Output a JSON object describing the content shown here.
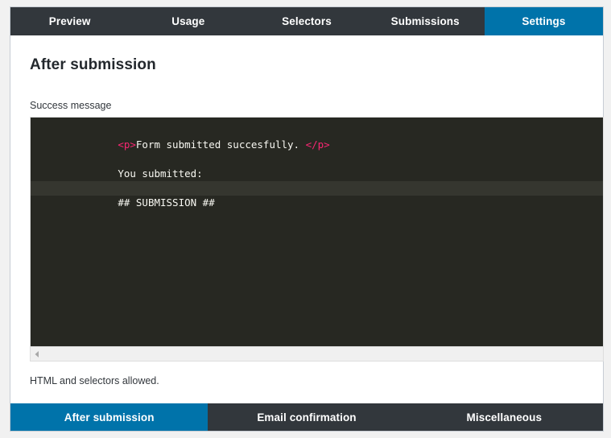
{
  "colors": {
    "accent": "#0073aa",
    "tabbar_bg": "#32373c",
    "panel_bg": "#ffffff",
    "page_bg": "#f1f1f1",
    "editor_bg": "#272822",
    "editor_highlight_bg": "#35362f",
    "editor_text": "#f8f8f2",
    "editor_tag": "#f92672"
  },
  "top_tabs": [
    {
      "label": "Preview",
      "active": false
    },
    {
      "label": "Usage",
      "active": false
    },
    {
      "label": "Selectors",
      "active": false
    },
    {
      "label": "Submissions",
      "active": false
    },
    {
      "label": "Settings",
      "active": true
    }
  ],
  "main": {
    "title": "After submission",
    "field": {
      "label": "Success message",
      "help": "HTML and selectors allowed."
    },
    "editor": {
      "lines": [
        {
          "highlight": false,
          "tokens": [
            {
              "type": "tag",
              "text": "<p>"
            },
            {
              "type": "text",
              "text": "Form submitted succesfully. "
            },
            {
              "type": "tag",
              "text": "</p>"
            }
          ]
        },
        {
          "highlight": false,
          "tokens": []
        },
        {
          "highlight": false,
          "tokens": [
            {
              "type": "text",
              "text": "You submitted:"
            }
          ]
        },
        {
          "highlight": false,
          "tokens": []
        },
        {
          "highlight": true,
          "tokens": [
            {
              "type": "text",
              "text": "## SUBMISSION ##"
            }
          ]
        }
      ]
    },
    "scrollbar": {
      "left_arrow_icon": "triangle-left-icon"
    }
  },
  "bottom_tabs": [
    {
      "label": "After submission",
      "active": true
    },
    {
      "label": "Email confirmation",
      "active": false
    },
    {
      "label": "Miscellaneous",
      "active": false
    }
  ]
}
